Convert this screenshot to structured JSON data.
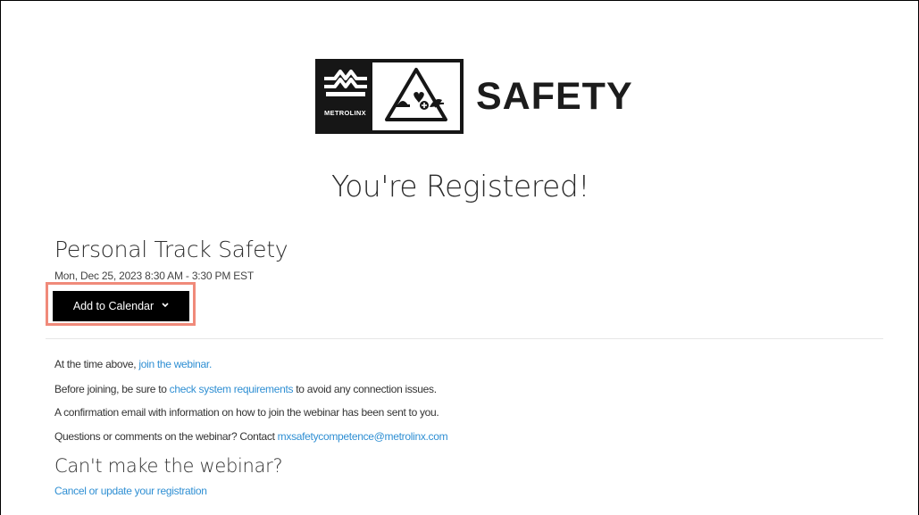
{
  "header": {
    "brand_word": "METROLINX",
    "safety_word": "SAFETY",
    "logo_icon": "metrolinx-logo-icon",
    "safety_icon": "safety-triangle-icon"
  },
  "title": "You're Registered!",
  "event": {
    "name": "Personal Track Safety",
    "datetime": "Mon, Dec 25, 2023 8:30 AM - 3:30 PM EST"
  },
  "calendar_button": {
    "label": "Add to Calendar",
    "icon": "chevron-down-icon"
  },
  "info": {
    "line1_prefix": "At the time above, ",
    "line1_link": "join the webinar.",
    "line2_prefix": "Before joining, be sure to ",
    "line2_link": "check system requirements",
    "line2_suffix": " to avoid any connection issues.",
    "line3": "A confirmation email with information on how to join the webinar has been sent to you.",
    "line4_prefix": "Questions or comments on the webinar? Contact ",
    "line4_link": "mxsafetycompetence@metrolinx.com"
  },
  "cant_make": {
    "heading": "Can't make the webinar?",
    "link": "Cancel or update your registration"
  },
  "colors": {
    "link": "#2f8fd3",
    "button_bg": "#000000",
    "highlight": "#f08a7a"
  }
}
